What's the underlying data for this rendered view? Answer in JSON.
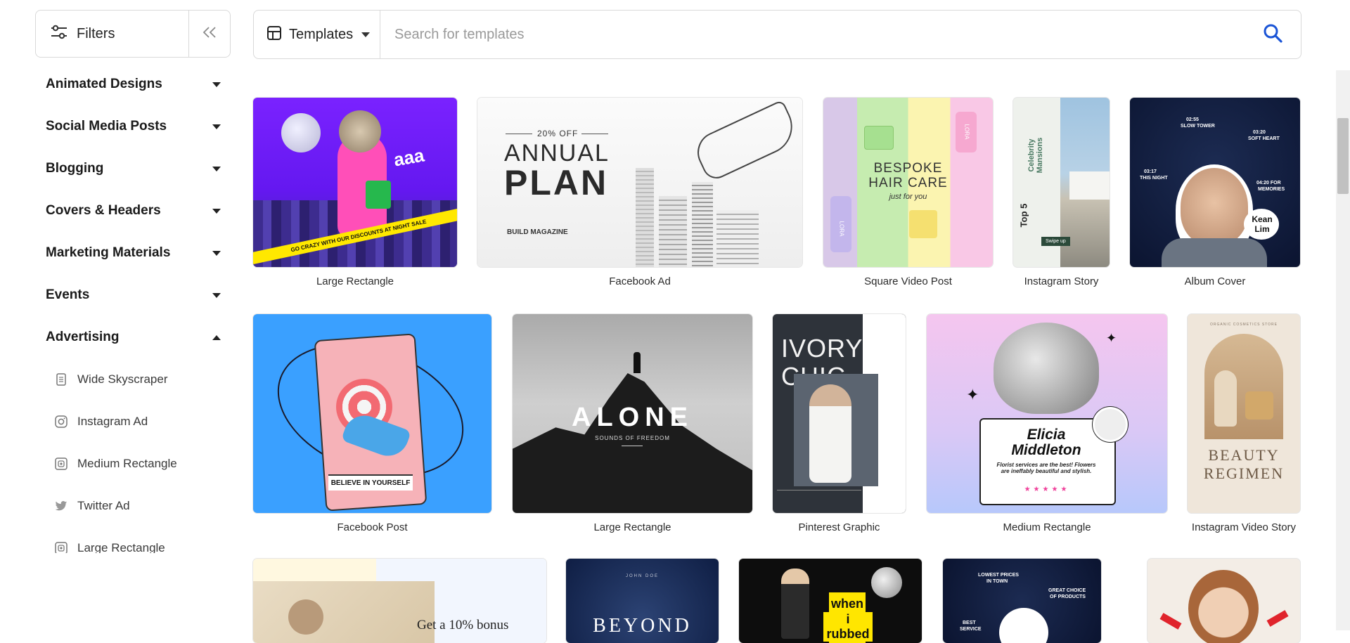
{
  "sidebar": {
    "filters_label": "Filters",
    "categories": [
      {
        "label": "Animated Designs"
      },
      {
        "label": "Social Media Posts"
      },
      {
        "label": "Blogging"
      },
      {
        "label": "Covers & Headers"
      },
      {
        "label": "Marketing Materials"
      },
      {
        "label": "Events"
      },
      {
        "label": "Advertising"
      }
    ],
    "sub_items": [
      {
        "label": "Wide Skyscraper",
        "icon": "document-icon"
      },
      {
        "label": "Instagram Ad",
        "icon": "instagram-icon"
      },
      {
        "label": "Medium Rectangle",
        "icon": "image-icon"
      },
      {
        "label": "Twitter Ad",
        "icon": "twitter-icon"
      },
      {
        "label": "Large Rectangle",
        "icon": "image-icon"
      }
    ]
  },
  "search": {
    "type_label": "Templates",
    "placeholder": "Search for templates"
  },
  "colors": {
    "accent": "#1a54d6",
    "border": "#d9d9d9"
  },
  "templates": {
    "row1": [
      {
        "caption": "Large Rectangle",
        "texts": [
          "aaa",
          "GO CRAZY WITH OUR DISCOUNTS AT NIGHT SALE"
        ]
      },
      {
        "caption": "Facebook Ad",
        "texts": [
          "20% OFF",
          "ANNUAL",
          "PLAN",
          "BUILD MAGAZINE"
        ]
      },
      {
        "caption": "Square Video Post",
        "texts": [
          "BESPOKE",
          "HAIR CARE",
          "just for you",
          "LORA",
          "LORA"
        ]
      },
      {
        "caption": "Instagram Story",
        "texts": [
          "Celebrity Mansions",
          "Top 5",
          "Swipe up"
        ]
      },
      {
        "caption": "Album Cover",
        "texts": [
          "02:55",
          "SLOW TOWER",
          "03:20",
          "SOFT HEART",
          "03:17",
          "THIS NIGHT",
          "04:20 FOR",
          "MEMORIES",
          "Kean",
          "Lim"
        ]
      }
    ],
    "row2": [
      {
        "caption": "Facebook Post",
        "texts": [
          "BELIEVE IN YOURSELF"
        ]
      },
      {
        "caption": "Large Rectangle",
        "texts": [
          "ALONE",
          "SOUNDS OF FREEDOM"
        ]
      },
      {
        "caption": "Pinterest Graphic",
        "texts": [
          "IVORY",
          "CHIC"
        ]
      },
      {
        "caption": "Medium Rectangle",
        "texts": [
          "Elicia",
          "Middleton",
          "Florist services are the best! Flowers are ineffably beautiful and stylish."
        ]
      },
      {
        "caption": "Instagram Video Story",
        "texts": [
          "BEAUTY",
          "REGIMEN",
          "ORGANIC COSMETICS STORE"
        ]
      }
    ],
    "row3": [
      {
        "texts": [
          "Get a 10% bonus"
        ]
      },
      {
        "texts": [
          "JOHN DOE",
          "BEYOND"
        ]
      },
      {
        "texts": [
          "when",
          "i rubbed"
        ]
      },
      {
        "texts": [
          "LOWEST PRICES",
          "IN TOWN",
          "GREAT CHOICE",
          "OF PRODUCTS",
          "BEST",
          "SERVICE"
        ]
      },
      {
        "texts": []
      }
    ]
  }
}
